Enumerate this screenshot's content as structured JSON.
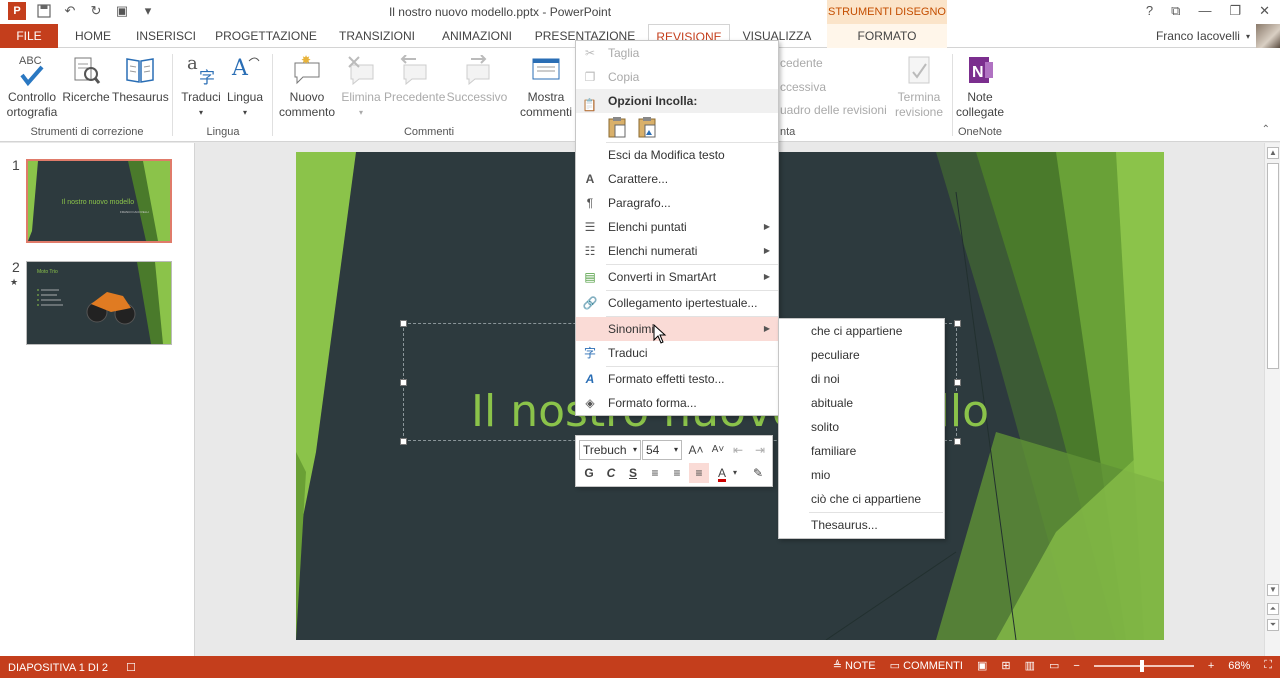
{
  "titlebar": {
    "document_title": "Il nostro nuovo modello.pptx - PowerPoint",
    "contextual_group": "STRUMENTI DISEGNO",
    "window_controls": [
      "?",
      "⧉",
      "—",
      "❐",
      "✕"
    ]
  },
  "tabs": [
    {
      "id": "file",
      "label": "FILE"
    },
    {
      "id": "home",
      "label": "HOME"
    },
    {
      "id": "inserisci",
      "label": "INSERISCI"
    },
    {
      "id": "progettazione",
      "label": "PROGETTAZIONE"
    },
    {
      "id": "transizioni",
      "label": "TRANSIZIONI"
    },
    {
      "id": "animazioni",
      "label": "ANIMAZIONI"
    },
    {
      "id": "presentazione",
      "label": "PRESENTAZIONE"
    },
    {
      "id": "revisione",
      "label": "REVISIONE"
    },
    {
      "id": "visualizza",
      "label": "VISUALIZZA"
    },
    {
      "id": "formato",
      "label": "FORMATO"
    }
  ],
  "user": {
    "name": "Franco Iacovelli"
  },
  "ribbon": {
    "controllo": {
      "line1": "Controllo",
      "line2": "ortografia"
    },
    "ricerche": "Ricerche",
    "thesaurus": "Thesaurus",
    "traduci": "Traduci",
    "lingua": "Lingua",
    "nuovo_commento": {
      "line1": "Nuovo",
      "line2": "commento"
    },
    "elimina": "Elimina",
    "precedente": "Precedente",
    "successivo": "Successivo",
    "mostra_commenti": {
      "line1": "Mostra",
      "line2": "commenti"
    },
    "rev_precedente": "cedente",
    "rev_successiva": "ccessiva",
    "rev_riquadro": "uadro delle revisioni",
    "termina": {
      "line1": "Termina",
      "line2": "revisione"
    },
    "note": {
      "line1": "Note",
      "line2": "collegate"
    },
    "groups": {
      "strumenti": "Strumenti di correzione",
      "lingua": "Lingua",
      "commenti": "Commenti",
      "confronta": "nta",
      "onenote": "OneNote"
    },
    "abc_icon_text": "ABC"
  },
  "thumbnails": [
    {
      "number": "1",
      "title": "Il nostro nuovo modello",
      "subtitle": "FRANCO IACOVELLI"
    },
    {
      "number": "2",
      "star": "★",
      "title": "Moto Trio"
    }
  ],
  "slide": {
    "title": "Il nostro nuovo modello"
  },
  "context_menu": {
    "taglia": "Taglia",
    "copia": "Copia",
    "opzioni_incolla": "Opzioni Incolla:",
    "esci": "Esci da Modifica testo",
    "carattere": "Carattere...",
    "paragrafo": "Paragrafo...",
    "elenchi_puntati": "Elenchi puntati",
    "elenchi_numerati": "Elenchi numerati",
    "converti": "Converti in SmartArt",
    "collegamento": "Collegamento ipertestuale...",
    "sinonimi": "Sinonimi",
    "traduci": "Traduci",
    "formato_effetti": "Formato effetti testo...",
    "formato_forma": "Formato forma...",
    "submenu_arrow": "▶"
  },
  "mini_toolbar": {
    "font": "Trebuch",
    "size": "54",
    "bold": "G",
    "italic": "C",
    "underline": "S"
  },
  "synonyms": {
    "items": [
      "che ci appartiene",
      "peculiare",
      "di noi",
      "abituale",
      "solito",
      "familiare",
      "mio",
      "ciò che ci appartiene"
    ],
    "thesaurus": "Thesaurus..."
  },
  "statusbar": {
    "slide_info": "DIAPOSITIVA 1 DI 2",
    "note": "NOTE",
    "commenti": "COMMENTI",
    "zoom": "68%"
  },
  "colors": {
    "accent": "#c43e1c",
    "slide_bg": "#2d3a3e",
    "slide_green": "#8bc34a",
    "hover": "#fadbd6"
  }
}
